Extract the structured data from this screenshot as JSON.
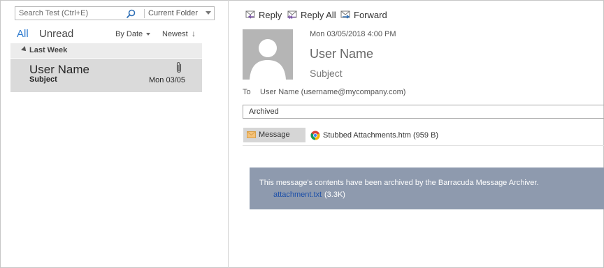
{
  "search": {
    "placeholder": "Search Test (Ctrl+E)",
    "scope": "Current Folder"
  },
  "filters": {
    "all": "All",
    "unread": "Unread",
    "sort_by": "By Date",
    "sort_order": "Newest",
    "sort_arrow": "↓"
  },
  "message_list": {
    "group": "Last Week",
    "items": [
      {
        "sender": "User Name",
        "subject": "Subject",
        "date": "Mon 03/05",
        "has_attachment": true
      }
    ]
  },
  "toolbar": {
    "reply": "Reply",
    "reply_all": "Reply All",
    "forward": "Forward"
  },
  "reading": {
    "sent": "Mon 03/05/2018 4:00 PM",
    "from": "User Name",
    "subject": "Subject",
    "to_label": "To",
    "to": "User Name (username@mycompany.com)",
    "category": "Archived",
    "attachments": {
      "message_tab": "Message",
      "file": "Stubbed Attachments.htm (959 B)"
    },
    "banner": {
      "notice": "This message's contents have been archived by the Barracuda Message Archiver.",
      "link": "attachment.txt",
      "size": "(3.3K)"
    }
  },
  "colors": {
    "accent": "#2e7bcf",
    "selected_row": "#dadada",
    "banner_bg": "#8e9aae",
    "link": "#1c4fa8"
  },
  "icons": [
    "search-icon",
    "paperclip-icon",
    "reply-icon",
    "reply-all-icon",
    "forward-icon",
    "avatar-placeholder-icon",
    "envelope-icon",
    "chrome-icon"
  ]
}
